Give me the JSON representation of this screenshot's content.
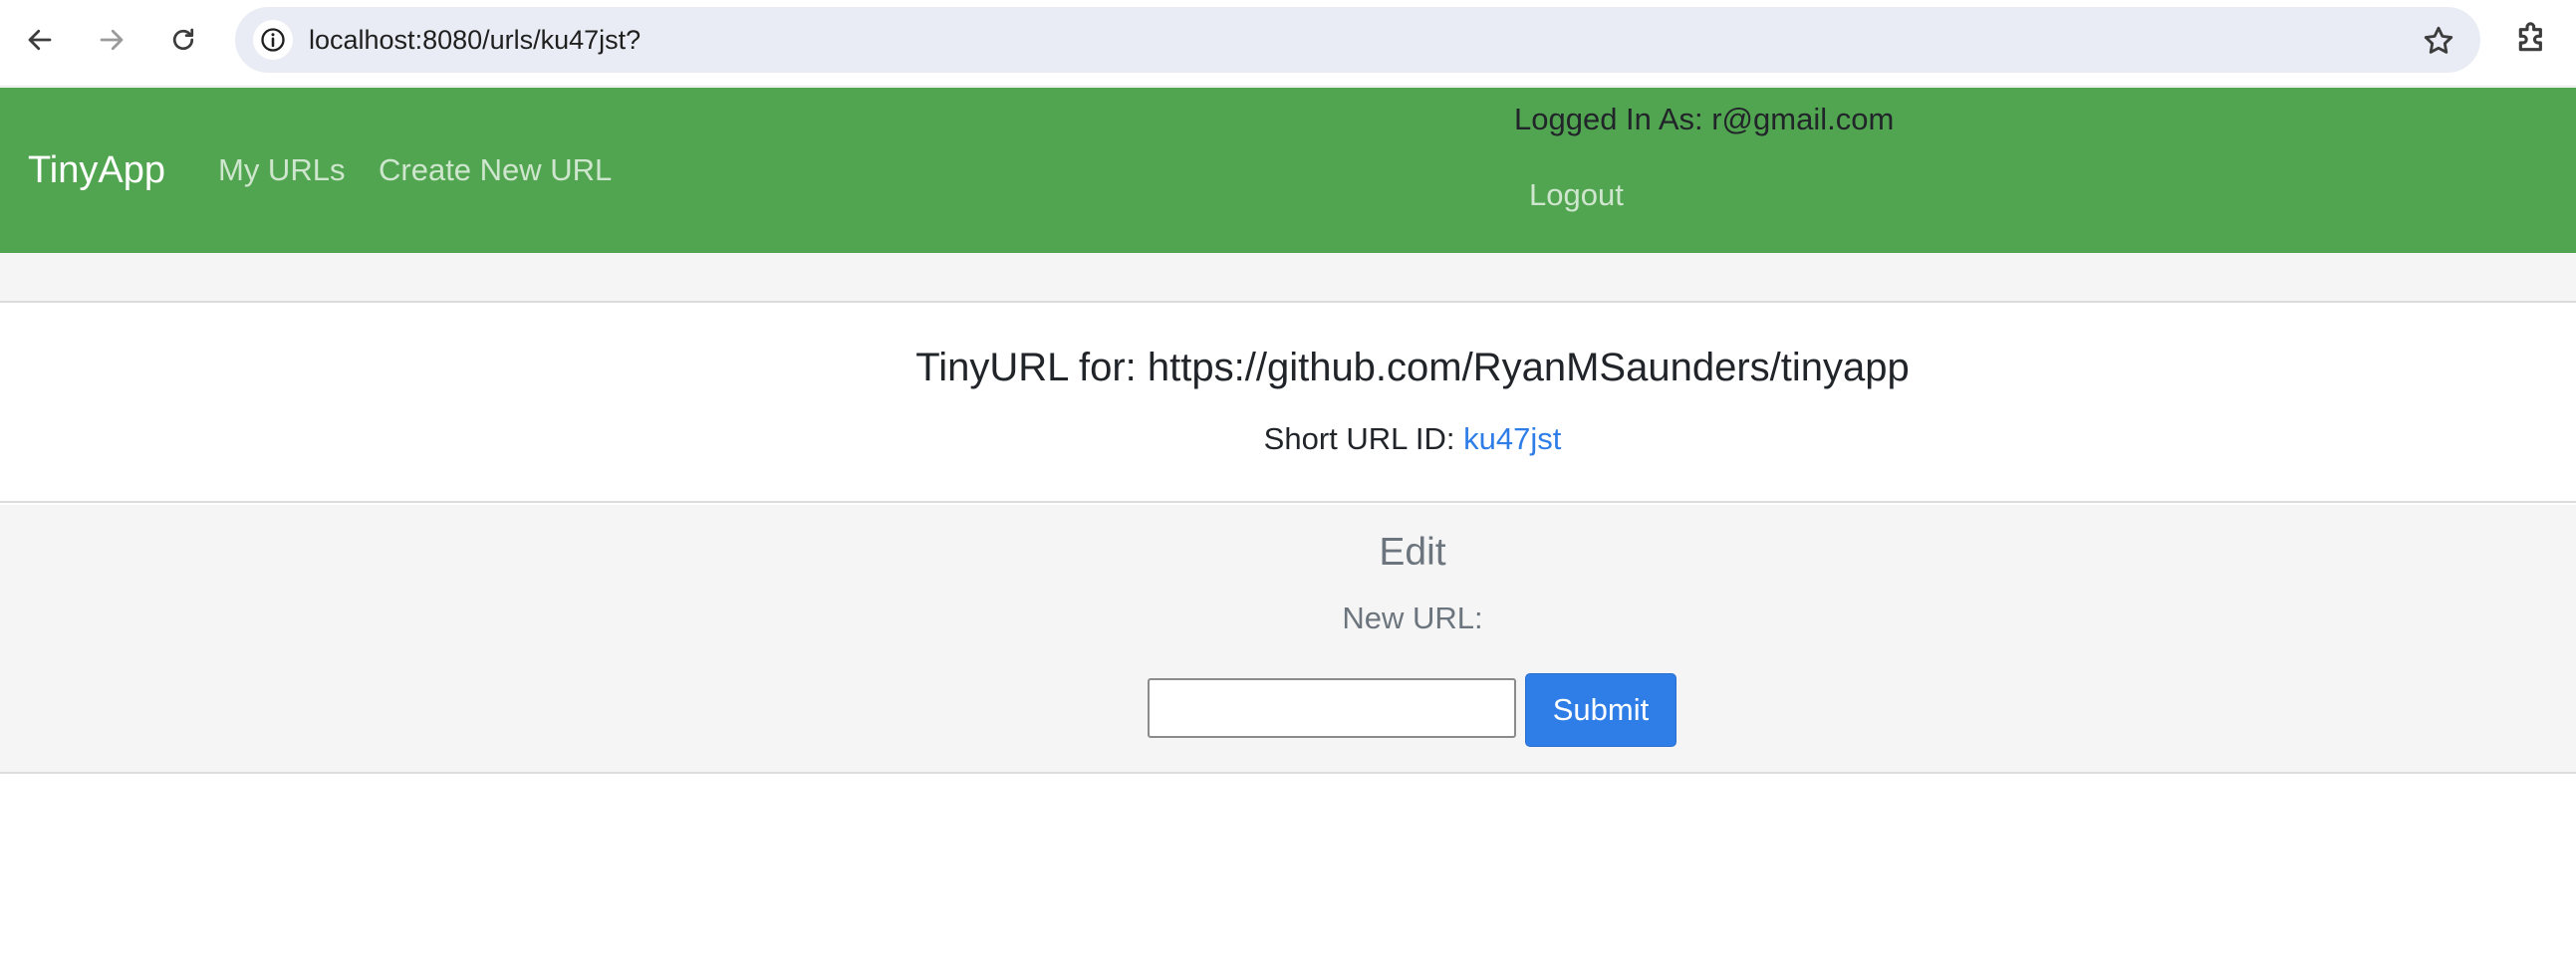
{
  "browser": {
    "url": "localhost:8080/urls/ku47jst?",
    "back_icon": "arrow-left-icon",
    "forward_icon": "arrow-right-icon",
    "reload_icon": "reload-icon",
    "info_icon": "info-icon",
    "bookmark_icon": "star-icon",
    "extensions_icon": "puzzle-icon"
  },
  "navbar": {
    "brand": "TinyApp",
    "links": [
      "My URLs",
      "Create New URL"
    ],
    "logged_in": "Logged In As: r@gmail.com",
    "logout": "Logout",
    "background_color": "#52a550"
  },
  "main": {
    "title": "TinyURL for: https://github.com/RyanMSaunders/tinyapp",
    "short_label": "Short URL ID:",
    "short_id": "ku47jst",
    "link_color": "#2f7ee8"
  },
  "edit": {
    "heading": "Edit",
    "label": "New URL:",
    "input_value": "",
    "submit_label": "Submit",
    "button_color": "#2f7ee8"
  }
}
